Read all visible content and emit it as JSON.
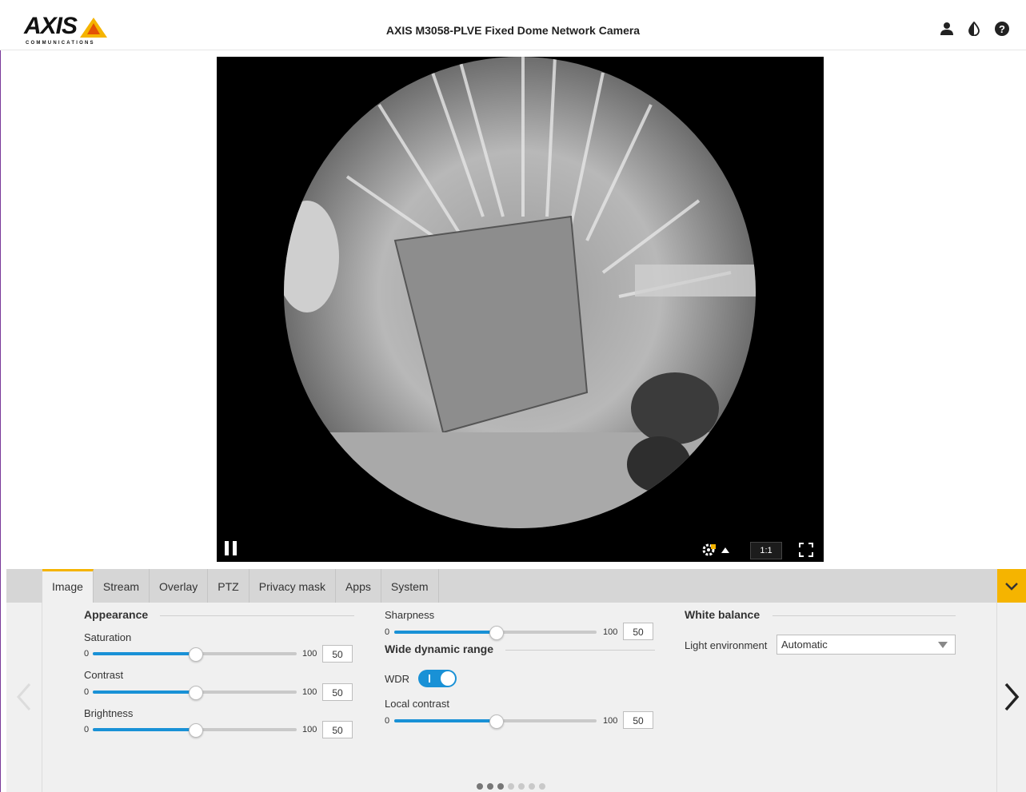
{
  "header": {
    "brand": "AXIS",
    "brand_sub": "COMMUNICATIONS",
    "title": "AXIS M3058-PLVE Fixed Dome Network Camera",
    "icons": [
      "user-icon",
      "contrast-icon",
      "help-icon"
    ]
  },
  "video": {
    "ratio_label": "1:1",
    "controls": [
      "pause-icon",
      "stream-settings-icon",
      "fullscreen-icon"
    ]
  },
  "tabs": [
    {
      "label": "Image",
      "active": true
    },
    {
      "label": "Stream"
    },
    {
      "label": "Overlay"
    },
    {
      "label": "PTZ"
    },
    {
      "label": "Privacy mask"
    },
    {
      "label": "Apps"
    },
    {
      "label": "System"
    }
  ],
  "appearance": {
    "title": "Appearance",
    "saturation": {
      "label": "Saturation",
      "min": "0",
      "max": "100",
      "value": "50",
      "level": 0.5
    },
    "contrast": {
      "label": "Contrast",
      "min": "0",
      "max": "100",
      "value": "50",
      "level": 0.5
    },
    "brightness": {
      "label": "Brightness",
      "min": "0",
      "max": "100",
      "value": "50",
      "level": 0.5
    }
  },
  "sharpness": {
    "label": "Sharpness",
    "min": "0",
    "max": "100",
    "value": "50",
    "level": 0.5
  },
  "wdr": {
    "title": "Wide dynamic range",
    "wdr_label": "WDR",
    "wdr_on": true,
    "local_contrast": {
      "label": "Local contrast",
      "min": "0",
      "max": "100",
      "value": "50",
      "level": 0.5
    }
  },
  "white_balance": {
    "title": "White balance",
    "light_env_label": "Light environment",
    "light_env_value": "Automatic"
  },
  "pager": {
    "count": 7,
    "active": [
      0,
      1,
      2
    ]
  },
  "colors": {
    "accent": "#f5b400",
    "slider": "#1991d6"
  }
}
